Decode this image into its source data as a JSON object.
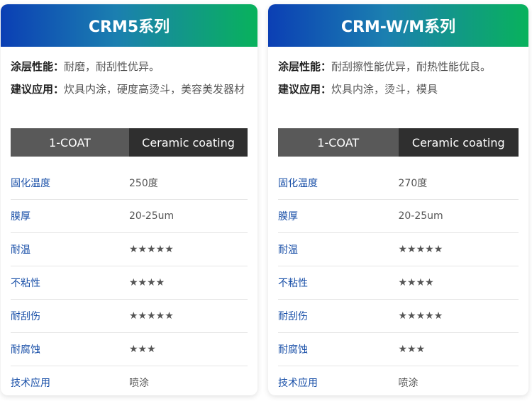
{
  "cards": [
    {
      "title": "CRM5系列",
      "coating_label": "涂层性能：",
      "coating_value": "耐磨，耐刮性优异。",
      "usage_label": "建议应用：",
      "usage_value": "炊具内涂，硬度高烫斗，美容美发器材",
      "header_col1": "1-COAT",
      "header_col2": "Ceramic coating",
      "rows": [
        {
          "key": "固化温度",
          "value": "250度"
        },
        {
          "key": "膜厚",
          "value": "20-25um"
        },
        {
          "key": "耐温",
          "value": "★★★★★"
        },
        {
          "key": "不粘性",
          "value": "★★★★"
        },
        {
          "key": "耐刮伤",
          "value": "★★★★★"
        },
        {
          "key": "耐腐蚀",
          "value": "★★★"
        },
        {
          "key": "技术应用",
          "value": "喷涂"
        }
      ]
    },
    {
      "title": "CRM-W/M系列",
      "coating_label": "涂层性能：",
      "coating_value": "耐刮擦性能优异，耐热性能优良。",
      "usage_label": "建议应用：",
      "usage_value": "炊具内涂，烫斗，模具",
      "header_col1": "1-COAT",
      "header_col2": "Ceramic coating",
      "rows": [
        {
          "key": "固化温度",
          "value": "270度"
        },
        {
          "key": "膜厚",
          "value": "20-25um"
        },
        {
          "key": "耐温",
          "value": "★★★★★"
        },
        {
          "key": "不粘性",
          "value": "★★★★"
        },
        {
          "key": "耐刮伤",
          "value": "★★★★★"
        },
        {
          "key": "耐腐蚀",
          "value": "★★★"
        },
        {
          "key": "技术应用",
          "value": "喷涂"
        }
      ]
    }
  ]
}
